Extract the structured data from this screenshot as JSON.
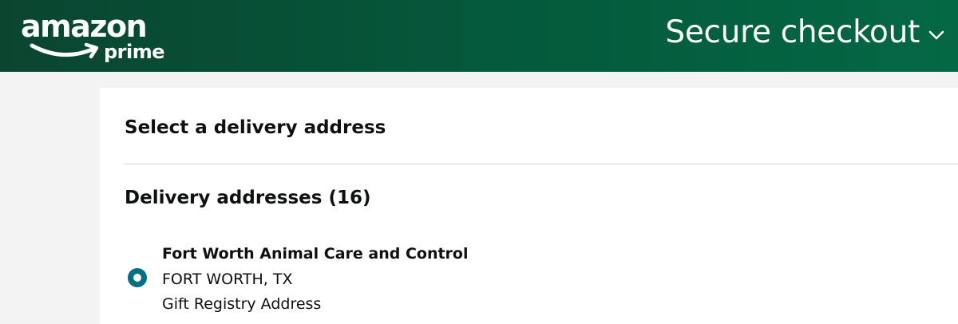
{
  "header": {
    "logo": {
      "word": "amazon",
      "sub": "prime",
      "icon": "amazon-smile-logo"
    },
    "secure_checkout_label": "Secure checkout",
    "dropdown_icon": "chevron-down-icon"
  },
  "main": {
    "title": "Select a delivery address",
    "addresses_heading": "Delivery addresses (16)",
    "addresses": [
      {
        "name": "Fort Worth Animal Care and Control",
        "city_state": "FORT WORTH, TX",
        "note": "Gift Registry Address",
        "selected": true
      }
    ]
  },
  "colors": {
    "header_gradient_start": "#0a4530",
    "header_gradient_end": "#046845",
    "radio_selected": "#007185",
    "page_background": "#f3f3f3",
    "panel_background": "#ffffff",
    "divider": "#d5d9d9"
  }
}
